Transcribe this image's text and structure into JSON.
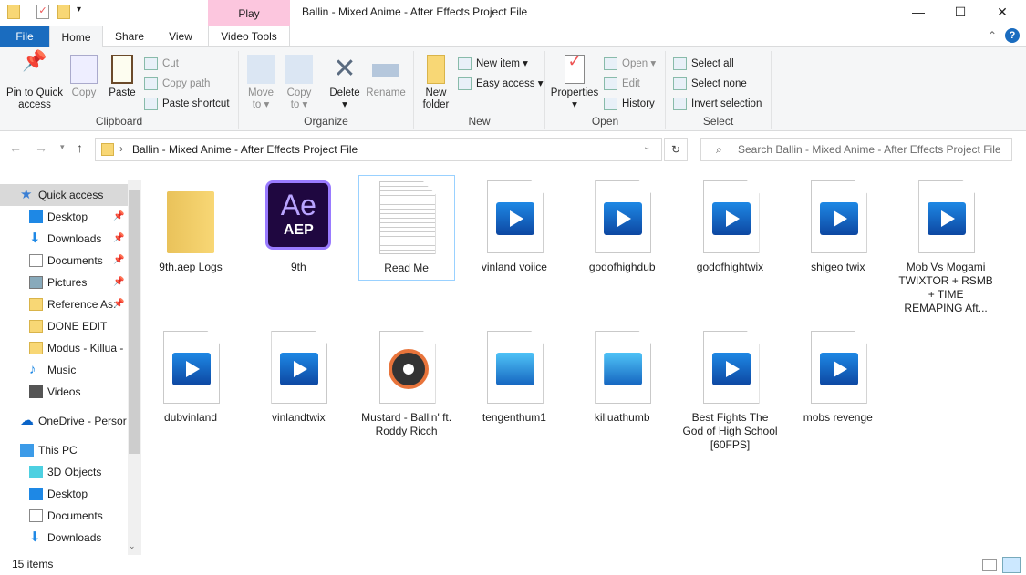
{
  "window": {
    "title": "Ballin - Mixed Anime - After Effects Project File",
    "context_tab": "Play",
    "minimize": "—",
    "maximize": "☐",
    "close": "✕"
  },
  "tabs": [
    "File",
    "Home",
    "Share",
    "View",
    "Video Tools"
  ],
  "ribbon": {
    "clipboard": {
      "label": "Clipboard",
      "pin": "Pin to Quick access",
      "copy": "Copy",
      "paste": "Paste",
      "cut": "Cut",
      "copy_path": "Copy path",
      "paste_shortcut": "Paste shortcut"
    },
    "organize": {
      "label": "Organize",
      "move_to": "Move to",
      "copy_to": "Copy to",
      "delete": "Delete",
      "rename": "Rename"
    },
    "new": {
      "label": "New",
      "new_folder": "New folder",
      "new_item": "New item",
      "easy_access": "Easy access"
    },
    "open": {
      "label": "Open",
      "properties": "Properties",
      "open": "Open",
      "edit": "Edit",
      "history": "History"
    },
    "select": {
      "label": "Select",
      "select_all": "Select all",
      "select_none": "Select none",
      "invert": "Invert selection"
    }
  },
  "address": {
    "path": "Ballin - Mixed Anime - After Effects Project File",
    "search_placeholder": "Search Ballin - Mixed Anime - After Effects Project File"
  },
  "nav": [
    {
      "label": "Quick access",
      "icon": "star-icon",
      "level": 0,
      "selected": true
    },
    {
      "label": "Desktop",
      "icon": "desktop-icon",
      "level": 1,
      "pinned": true
    },
    {
      "label": "Downloads",
      "icon": "download-icon",
      "level": 1,
      "pinned": true
    },
    {
      "label": "Documents",
      "icon": "document-icon",
      "level": 1,
      "pinned": true
    },
    {
      "label": "Pictures",
      "icon": "pictures-icon",
      "level": 1,
      "pinned": true
    },
    {
      "label": "Reference As:",
      "icon": "folder-icon",
      "level": 1,
      "pinned": true
    },
    {
      "label": "DONE EDIT",
      "icon": "folder-icon",
      "level": 1
    },
    {
      "label": "Modus - Killua -",
      "icon": "folder-icon",
      "level": 1
    },
    {
      "label": "Music",
      "icon": "music-icon",
      "level": 1
    },
    {
      "label": "Videos",
      "icon": "videos-icon",
      "level": 1
    },
    {
      "label": "OneDrive - Persor",
      "icon": "cloud-icon",
      "level": 0
    },
    {
      "label": "This PC",
      "icon": "pc-icon",
      "level": 0
    },
    {
      "label": "3D Objects",
      "icon": "cube-icon",
      "level": 1
    },
    {
      "label": "Desktop",
      "icon": "desktop-icon",
      "level": 1
    },
    {
      "label": "Documents",
      "icon": "document-icon",
      "level": 1
    },
    {
      "label": "Downloads",
      "icon": "download-icon",
      "level": 1
    }
  ],
  "files": [
    {
      "name": "9th.aep Logs",
      "type": "folder"
    },
    {
      "name": "9th",
      "type": "aep",
      "badge": "Ae",
      "ext": "AEP"
    },
    {
      "name": "Read Me",
      "type": "text",
      "selected": true
    },
    {
      "name": "vinland voiice",
      "type": "video"
    },
    {
      "name": "godofhighdub",
      "type": "video"
    },
    {
      "name": "godofhightwix",
      "type": "video"
    },
    {
      "name": "shigeo twix",
      "type": "video"
    },
    {
      "name": "Mob Vs Mogami TWIXTOR + RSMB + TIME REMAPING Aft...",
      "type": "video"
    },
    {
      "name": "dubvinland",
      "type": "video"
    },
    {
      "name": "vinlandtwix",
      "type": "video"
    },
    {
      "name": "Mustard - Ballin' ft. Roddy Ricch",
      "type": "audio"
    },
    {
      "name": "tengenthum1",
      "type": "image"
    },
    {
      "name": "killuathumb",
      "type": "image"
    },
    {
      "name": "Best Fights The God of High School [60FPS]",
      "type": "video"
    },
    {
      "name": "mobs revenge",
      "type": "video"
    }
  ],
  "status": {
    "count": "15 items"
  },
  "colors": {
    "accent": "#1a6cbf",
    "context_tab": "#fcc6de",
    "selection": "#cce8ff"
  }
}
